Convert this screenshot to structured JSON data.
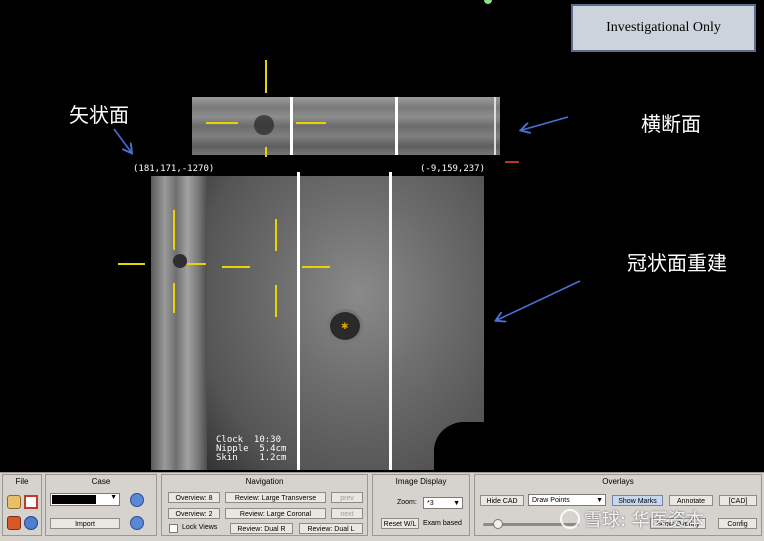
{
  "badge": {
    "text": "Investigational Only"
  },
  "views": {
    "sagittal_label": "矢状面",
    "transverse_label": "横断面",
    "coronal_label": "冠状面重建"
  },
  "coords": {
    "left": "(181,171,-1270)",
    "right": "(-9,159,237)"
  },
  "image_info": {
    "clock": "Clock  10:30",
    "nipple": "Nipple  5.4cm",
    "skin": "Skin    1.2cm"
  },
  "file": {
    "title": "File"
  },
  "case": {
    "title": "Case",
    "import_label": "Import"
  },
  "navigation": {
    "title": "Navigation",
    "overview_8": "Overview: 8",
    "overview_2": "Overview: 2",
    "review_large_transverse": "Review: Large Transverse",
    "review_large_coronal": "Review: Large Coronal",
    "prev": "prev",
    "next": "next",
    "lock_views": "Lock Views",
    "review_dual_r": "Review: Dual R",
    "review_dual_l": "Review: Dual L"
  },
  "image_display": {
    "title": "Image Display",
    "zoom_label": "Zoom:",
    "zoom_value": "*3",
    "reset_wl": "Reset W/L",
    "exam_based": "Exam based"
  },
  "overlays": {
    "title": "Overlays",
    "hide_cad": "Hide CAD",
    "draw_points": "Draw Points",
    "show_marks": "Show Marks",
    "annotate": "Annotate",
    "cad": "[CAD]",
    "show_overlay": "Show Overlay",
    "config": "Config"
  },
  "watermark": {
    "text": "雪球: 华医资本"
  },
  "colors": {
    "accent_blue": "#4a6fd6",
    "crosshair": "#e6d300",
    "toolbar_bg": "#d6d3ce"
  }
}
